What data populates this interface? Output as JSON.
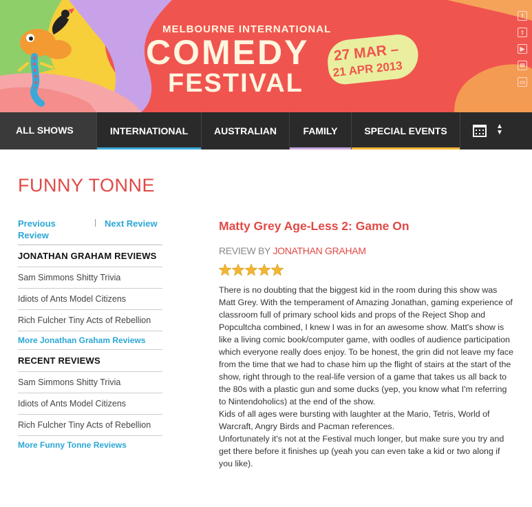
{
  "header": {
    "brand_small": "MELBOURNE INTERNATIONAL",
    "brand_line1": "COMEDY",
    "brand_line2": "FESTIVAL",
    "date_line1": "27 MAR –",
    "date_line2": "21 APR 2013",
    "social_icons": [
      "facebook-icon",
      "twitter-icon",
      "youtube-icon",
      "email-icon",
      "screen-icon"
    ],
    "colors": {
      "brand_red": "#f0544f",
      "cream": "#fff6e0",
      "date_badge": "#e9ef9f"
    }
  },
  "nav": {
    "items": [
      {
        "label": "ALL SHOWS",
        "bar_color": "#3a3a3a"
      },
      {
        "label": "INTERNATIONAL",
        "bar_color": "#3aa8d8"
      },
      {
        "label": "AUSTRALIAN",
        "bar_color": "#2a2a2a"
      },
      {
        "label": "FAMILY",
        "bar_color": "#c9a7e0"
      },
      {
        "label": "SPECIAL EVENTS",
        "bar_color": "#f2b632"
      }
    ],
    "calendar_icon": "calendar-icon",
    "sort_icon": "up-down-arrows-icon"
  },
  "page": {
    "title": "FUNNY TONNE"
  },
  "sidebar": {
    "previous_label": "Previous Review",
    "next_label": "Next Review",
    "author_section": {
      "heading": "JONATHAN GRAHAM REVIEWS",
      "items": [
        "Sam Simmons Shitty Trivia",
        "Idiots of Ants Model Citizens",
        "Rich Fulcher Tiny Acts of Rebellion"
      ],
      "more": "More Jonathan Graham Reviews"
    },
    "recent_section": {
      "heading": "RECENT REVIEWS",
      "items": [
        "Sam Simmons Shitty Trivia",
        "Idiots of Ants Model Citizens",
        "Rich Fulcher Tiny Acts of Rebellion"
      ],
      "more": "More Funny Tonne Reviews"
    }
  },
  "review": {
    "title": "Matty Grey Age-Less 2: Game On",
    "by_label": "REVIEW BY",
    "author": "JONATHAN GRAHAM",
    "rating": 5,
    "rating_max": 5,
    "star_color": "#f2b632",
    "paragraphs": [
      "There is no doubting that the biggest kid in the room during this show was Matt Grey. With the temperament of Amazing Jonathan, gaming experience of classroom full of primary school kids and props of the Reject Shop and Popcultcha combined, I knew I was in for an awesome show. Matt's show is like a living comic book/computer game, with oodles of audience participation which everyone really does enjoy. To be honest, the grin did not leave my face from the time that we had to chase him up the flight of stairs at the start of the show, right through to the real-life version of a game that takes us all back to the 80s with a plastic gun and some ducks (yep, you know what I'm referring to Nintendoholics) at the end of the show.",
      "Kids of all ages were bursting with laughter at the Mario, Tetris, World of Warcraft, Angry Birds and Pacman references.",
      "Unfortunately it's not at the Festival much longer, but make sure you try and get there before it finishes up (yeah you can even take a kid or two along if you like)."
    ]
  }
}
